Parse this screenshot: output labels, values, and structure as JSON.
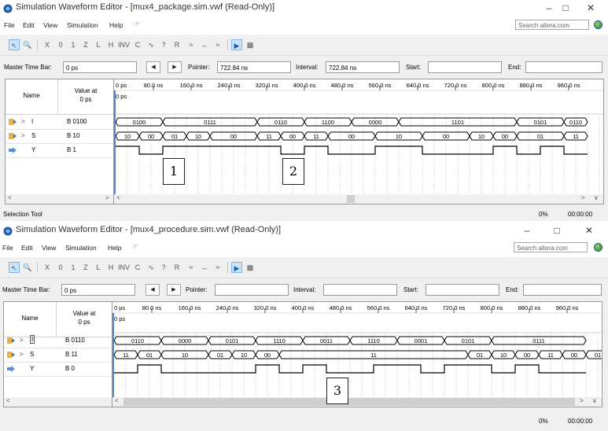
{
  "windows": [
    {
      "id": "top",
      "title": "Simulation Waveform Editor - [mux4_package.sim.vwf (Read-Only)]",
      "menu": [
        "File",
        "Edit",
        "View",
        "Simulation",
        "Help"
      ],
      "search_placeholder": "Search altera.com",
      "master_time_bar_label": "Master Time Bar:",
      "master_time_bar_value": "0 ps",
      "pointer_label": "Pointer:",
      "pointer_value": "722.84 ns",
      "interval_label": "Interval:",
      "interval_value": "722.84 ns",
      "start_label": "Start:",
      "start_value": "",
      "end_label": "End:",
      "end_value": "",
      "col_name": "Name",
      "col_value_line1": "Value at",
      "col_value_line2": "0 ps",
      "ruler_start": "0 ps",
      "ruler_ticks": [
        "80.0 ns",
        "160.0 ns",
        "240.0 ns",
        "320.0 ns",
        "400.0 ns",
        "480.0 ns",
        "560.0 ns",
        "640.0 ns",
        "720.0 ns",
        "800.0 ns",
        "880.0 ns",
        "960.0 ns"
      ],
      "cursor_label": "0 ps",
      "signals": [
        {
          "name": "I",
          "value": "B 0100",
          "type": "bus",
          "boxed": false,
          "icon": "input-bus-icon"
        },
        {
          "name": "S",
          "value": "B 10",
          "type": "bus",
          "boxed": false,
          "icon": "input-bus-icon"
        },
        {
          "name": "Y",
          "value": "B 1",
          "type": "bit",
          "boxed": false,
          "icon": "output-pin-icon"
        }
      ],
      "wave_I": [
        {
          "t0": 0,
          "t1": 100,
          "label": "0100"
        },
        {
          "t0": 100,
          "t1": 300,
          "label": "0111"
        },
        {
          "t0": 300,
          "t1": 400,
          "label": "0110"
        },
        {
          "t0": 400,
          "t1": 500,
          "label": "1100"
        },
        {
          "t0": 500,
          "t1": 600,
          "label": "0000"
        },
        {
          "t0": 600,
          "t1": 850,
          "label": "1101"
        },
        {
          "t0": 850,
          "t1": 950,
          "label": "0101"
        },
        {
          "t0": 950,
          "t1": 1000,
          "label": "0110"
        }
      ],
      "wave_S": [
        {
          "t0": 0,
          "t1": 50,
          "label": "10"
        },
        {
          "t0": 50,
          "t1": 100,
          "label": "00"
        },
        {
          "t0": 100,
          "t1": 150,
          "label": "01"
        },
        {
          "t0": 150,
          "t1": 200,
          "label": "10"
        },
        {
          "t0": 200,
          "t1": 300,
          "label": "00"
        },
        {
          "t0": 300,
          "t1": 350,
          "label": "11"
        },
        {
          "t0": 350,
          "t1": 400,
          "label": "00"
        },
        {
          "t0": 400,
          "t1": 450,
          "label": "11"
        },
        {
          "t0": 450,
          "t1": 550,
          "label": "00"
        },
        {
          "t0": 550,
          "t1": 650,
          "label": "10"
        },
        {
          "t0": 650,
          "t1": 750,
          "label": "00"
        },
        {
          "t0": 750,
          "t1": 800,
          "label": "10"
        },
        {
          "t0": 800,
          "t1": 850,
          "label": "00"
        },
        {
          "t0": 850,
          "t1": 950,
          "label": "01"
        },
        {
          "t0": 950,
          "t1": 1000,
          "label": "11"
        }
      ],
      "wave_Y": [
        {
          "t0": 0,
          "t1": 50,
          "v": 1
        },
        {
          "t0": 50,
          "t1": 100,
          "v": 0
        },
        {
          "t0": 100,
          "t1": 350,
          "v": 1
        },
        {
          "t0": 350,
          "t1": 400,
          "v": 0
        },
        {
          "t0": 400,
          "t1": 450,
          "v": 1
        },
        {
          "t0": 450,
          "t1": 550,
          "v": 0
        },
        {
          "t0": 550,
          "t1": 650,
          "v": 1
        },
        {
          "t0": 650,
          "t1": 800,
          "v": 0
        },
        {
          "t0": 800,
          "t1": 850,
          "v": 1
        },
        {
          "t0": 850,
          "t1": 900,
          "v": 0
        },
        {
          "t0": 900,
          "t1": 950,
          "v": 1
        },
        {
          "t0": 950,
          "t1": 1000,
          "v": 0
        }
      ],
      "annotations": [
        "1",
        "2"
      ],
      "status_left": "Selection Tool",
      "status_pct": "0%",
      "status_time": "00:00:00"
    },
    {
      "id": "bottom",
      "title": "Simulation Waveform Editor - [mux4_procedure.sim.vwf (Read-Only)]",
      "menu": [
        "File",
        "Edit",
        "View",
        "Simulation",
        "Help"
      ],
      "search_placeholder": "Search altera.com",
      "master_time_bar_label": "Master Time Bar:",
      "master_time_bar_value": "0 ps",
      "pointer_label": "Pointer:",
      "pointer_value": "",
      "interval_label": "Interval:",
      "interval_value": "",
      "start_label": "Start:",
      "start_value": "",
      "end_label": "End:",
      "end_value": "",
      "col_name": "Name",
      "col_value_line1": "Value at",
      "col_value_line2": "0 ps",
      "ruler_start": "0 ps",
      "ruler_ticks": [
        "80.0 ns",
        "160.0 ns",
        "240.0 ns",
        "320.0 ns",
        "400.0 ns",
        "480.0 ns",
        "560.0 ns",
        "640.0 ns",
        "720.0 ns",
        "800.0 ns",
        "880.0 ns",
        "960.0 ns"
      ],
      "cursor_label": "0 ps",
      "signals": [
        {
          "name": "I",
          "value": "B 0110",
          "type": "bus",
          "boxed": true,
          "icon": "input-bus-icon"
        },
        {
          "name": "S",
          "value": "B 11",
          "type": "bus",
          "boxed": false,
          "icon": "input-bus-icon"
        },
        {
          "name": "Y",
          "value": "B 0",
          "type": "bit",
          "boxed": false,
          "icon": "output-pin-icon"
        }
      ],
      "wave_I": [
        {
          "t0": 0,
          "t1": 100,
          "label": "0110"
        },
        {
          "t0": 100,
          "t1": 200,
          "label": "0000"
        },
        {
          "t0": 200,
          "t1": 300,
          "label": "0101"
        },
        {
          "t0": 300,
          "t1": 400,
          "label": "1110"
        },
        {
          "t0": 400,
          "t1": 500,
          "label": "0011"
        },
        {
          "t0": 500,
          "t1": 600,
          "label": "1110"
        },
        {
          "t0": 600,
          "t1": 700,
          "label": "0001"
        },
        {
          "t0": 700,
          "t1": 800,
          "label": "0101"
        },
        {
          "t0": 800,
          "t1": 1000,
          "label": "0111"
        }
      ],
      "wave_S": [
        {
          "t0": 0,
          "t1": 50,
          "label": "11"
        },
        {
          "t0": 50,
          "t1": 100,
          "label": "01"
        },
        {
          "t0": 100,
          "t1": 200,
          "label": "10"
        },
        {
          "t0": 200,
          "t1": 250,
          "label": "01"
        },
        {
          "t0": 250,
          "t1": 300,
          "label": "10"
        },
        {
          "t0": 300,
          "t1": 350,
          "label": "00"
        },
        {
          "t0": 350,
          "t1": 750,
          "label": "11"
        },
        {
          "t0": 750,
          "t1": 800,
          "label": "01"
        },
        {
          "t0": 800,
          "t1": 850,
          "label": "10"
        },
        {
          "t0": 850,
          "t1": 900,
          "label": "00"
        },
        {
          "t0": 900,
          "t1": 950,
          "label": "11"
        },
        {
          "t0": 950,
          "t1": 1000,
          "label": "00"
        },
        {
          "t0": 1000,
          "t1": 1050,
          "label": "01"
        }
      ],
      "wave_Y": [
        {
          "t0": 0,
          "t1": 50,
          "v": 0
        },
        {
          "t0": 50,
          "t1": 100,
          "v": 1
        },
        {
          "t0": 100,
          "t1": 300,
          "v": 0
        },
        {
          "t0": 300,
          "t1": 350,
          "v": 1
        },
        {
          "t0": 350,
          "t1": 400,
          "v": 0
        },
        {
          "t0": 400,
          "t1": 450,
          "v": 1
        },
        {
          "t0": 450,
          "t1": 550,
          "v": 0
        },
        {
          "t0": 550,
          "t1": 650,
          "v": 1
        },
        {
          "t0": 650,
          "t1": 700,
          "v": 0
        },
        {
          "t0": 700,
          "t1": 800,
          "v": 1
        },
        {
          "t0": 800,
          "t1": 850,
          "v": 0
        },
        {
          "t0": 850,
          "t1": 900,
          "v": 1
        },
        {
          "t0": 900,
          "t1": 1000,
          "v": 0
        }
      ],
      "annotations": [
        "3"
      ],
      "status_left": "",
      "status_pct": "0%",
      "status_time": "00:00:00"
    }
  ],
  "colors": {
    "accent": "#1e5fbf",
    "selection": "#cce4f7",
    "wave": "#000000"
  }
}
